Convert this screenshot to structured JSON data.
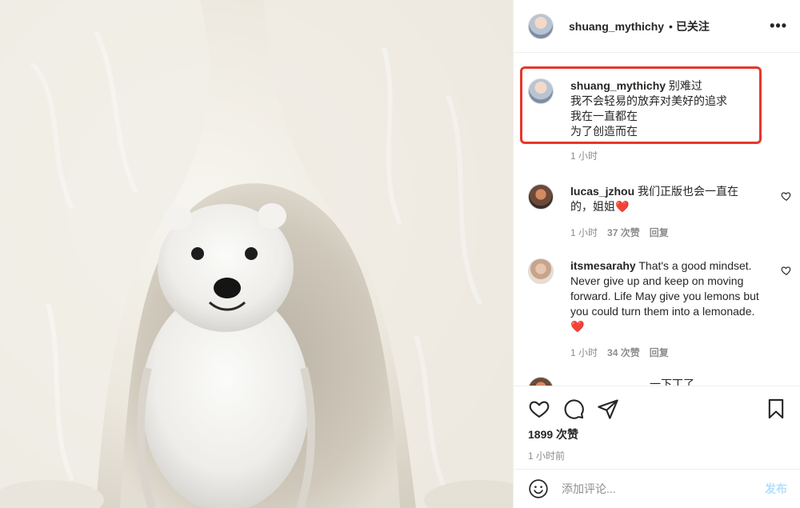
{
  "post": {
    "author": "shuang_mythichy",
    "separator": "•",
    "follow_status": "已关注",
    "more_icon": "more-dots-icon",
    "caption_lines": [
      "别难过",
      "我不会轻易的放弃对美好的追求",
      "我在一直都在",
      "为了创造而在"
    ],
    "caption_time": "1 小时",
    "highlight_color": "#e8362b"
  },
  "comments": [
    {
      "username": "lucas_jzhou",
      "text_line1": "我们正版也会一直在",
      "text_line2": "的，姐姐❤️",
      "time": "1 小时",
      "likes": "37 次赞",
      "reply": "回复"
    },
    {
      "username": "itsmesarahy",
      "text": "That's a good mindset. Never give up and keep on moving forward. Life May give you lemons but you could turn them into a lemonade. ❤️",
      "time": "1 小时",
      "likes": "34 次赞",
      "reply": "回复"
    },
    {
      "username": "",
      "text": "一下丁了……"
    }
  ],
  "actions": {
    "like_icon": "heart-outline-icon",
    "comment_icon": "comment-bubble-icon",
    "share_icon": "paper-plane-icon",
    "save_icon": "bookmark-icon"
  },
  "likes_total": "1899 次赞",
  "posted_ago": "1 小时前",
  "add_comment": {
    "placeholder": "添加评论...",
    "post_label": "发布",
    "emoji_icon": "emoji-smile-icon",
    "post_color": "#b2dffc"
  },
  "photo": {
    "subject": "polar-bear-cub-under-mother"
  }
}
